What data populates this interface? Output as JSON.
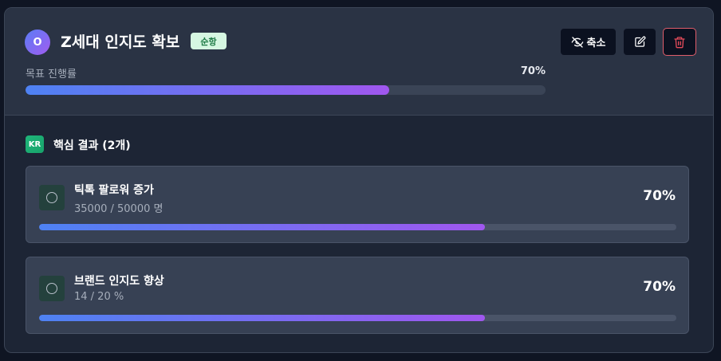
{
  "objective": {
    "avatar_letter": "O",
    "title": "Z세대 인지도 확보",
    "status_badge": "순항",
    "progress_label": "목표 진행률",
    "progress_text": "70%",
    "progress_value": 70
  },
  "actions": {
    "collapse_label": "축소",
    "collapse_icon": "eye-off-icon",
    "edit_icon": "edit-icon",
    "delete_icon": "trash-icon"
  },
  "key_results": {
    "tag": "KR",
    "heading": "핵심 결과 (2개)",
    "items": [
      {
        "name": "틱톡 팔로워 증가",
        "detail": "35000 / 50000 명",
        "percent_text": "70%",
        "progress_value": 70
      },
      {
        "name": "브랜드 인지도 향상",
        "detail": "14 / 20 %",
        "percent_text": "70%",
        "progress_value": 70
      }
    ]
  },
  "colors": {
    "accent_start": "#4e82f3",
    "accent_end": "#a057ef",
    "badge_bg": "#d6f7e2",
    "badge_text": "#1d7a45",
    "delete_border": "#e05d6a",
    "kr_tag": "#1fb57a"
  }
}
